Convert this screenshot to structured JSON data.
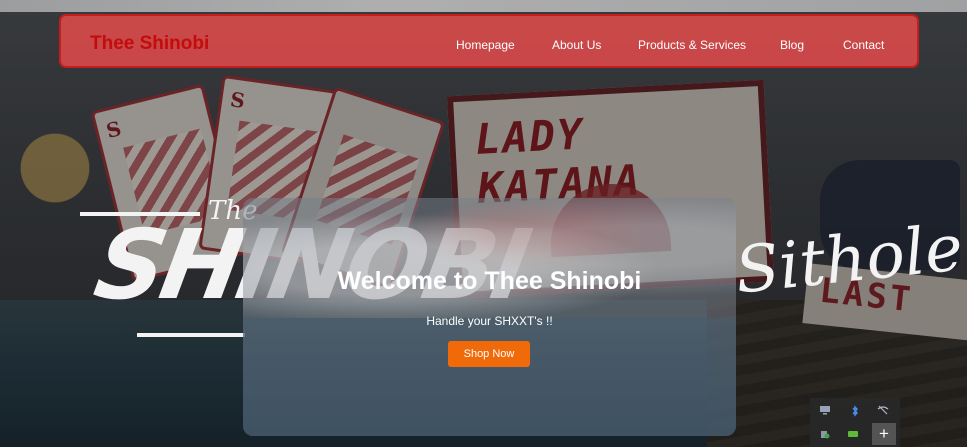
{
  "navbar": {
    "brand": "Thee Shinobi",
    "items": [
      {
        "label": "Homepage"
      },
      {
        "label": "About Us"
      },
      {
        "label": "Products & Services"
      },
      {
        "label": "Blog"
      },
      {
        "label": "Contact"
      }
    ]
  },
  "hero": {
    "title": "Welcome to Thee Shinobi",
    "subtitle": "Handle your SHXXT's !!",
    "button_label": "Shop Now"
  },
  "background": {
    "poster_text": "LADY KATANA",
    "sign_text": "LAST",
    "card_suit": "S",
    "logo_the": "The",
    "logo_main": "SHINOBI",
    "logo_right": "Sithole"
  },
  "tray": {
    "icons": [
      "monitor-icon",
      "bluetooth-icon",
      "network-icon",
      "security-icon",
      "gpu-icon"
    ],
    "plus": "+"
  },
  "colors": {
    "navbar_bg": "#e24a4a",
    "brand": "#c40c0c",
    "button": "#f06a0a"
  }
}
